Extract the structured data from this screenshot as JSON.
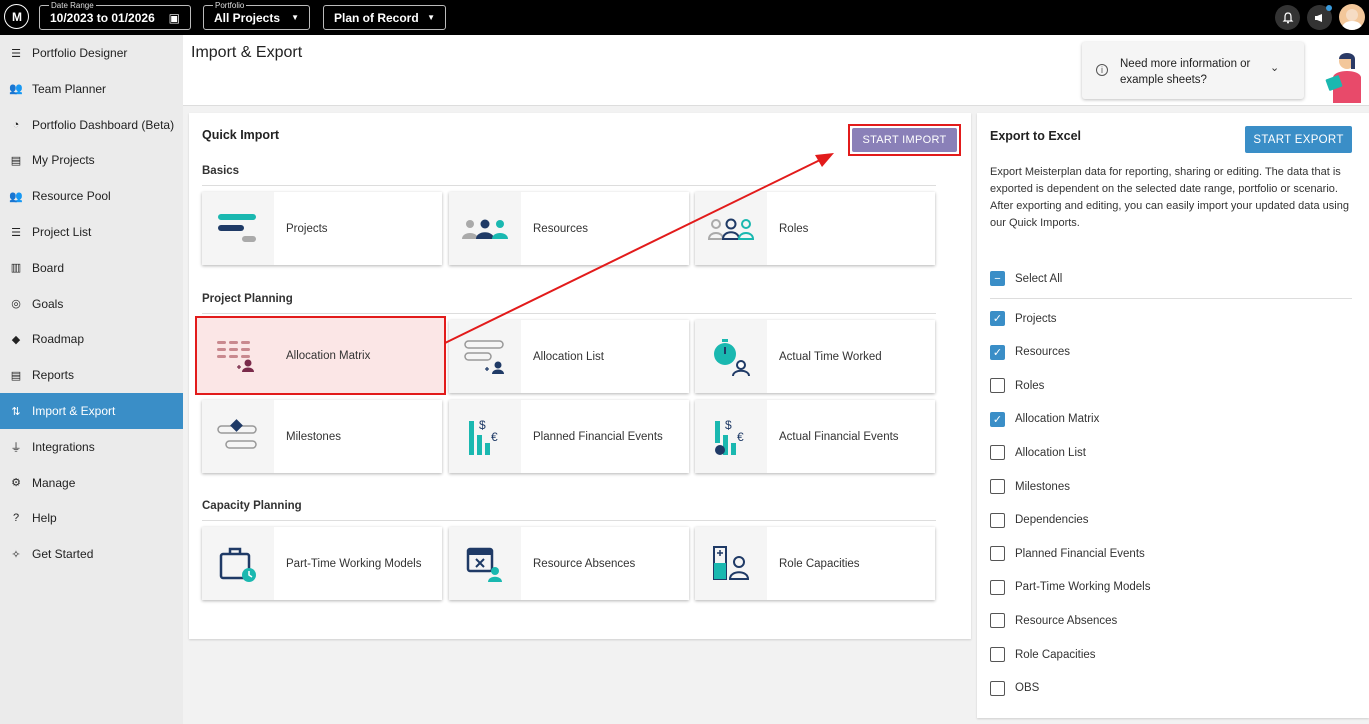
{
  "topbar": {
    "logo_text": "M",
    "date_range": {
      "label": "Date Range",
      "value": "10/2023 to 01/2026"
    },
    "portfolio": {
      "label": "Portfolio",
      "value": "All Projects"
    },
    "scenario": {
      "value": "Plan of Record"
    }
  },
  "sidebar": {
    "items": [
      {
        "label": "Portfolio Designer",
        "icon": "portfolio-designer-icon"
      },
      {
        "label": "Team Planner",
        "icon": "team-planner-icon"
      },
      {
        "label": "Portfolio Dashboard (Beta)",
        "icon": "dashboard-icon"
      },
      {
        "label": "My Projects",
        "icon": "my-projects-icon"
      },
      {
        "label": "Resource Pool",
        "icon": "resource-pool-icon"
      },
      {
        "label": "Project List",
        "icon": "list-icon"
      },
      {
        "label": "Board",
        "icon": "board-icon"
      },
      {
        "label": "Goals",
        "icon": "goals-icon"
      },
      {
        "label": "Roadmap",
        "icon": "roadmap-icon"
      },
      {
        "label": "Reports",
        "icon": "reports-icon"
      },
      {
        "label": "Import & Export",
        "icon": "import-export-icon",
        "active": true
      },
      {
        "label": "Integrations",
        "icon": "plug-icon"
      },
      {
        "label": "Manage",
        "icon": "gear-icon"
      },
      {
        "label": "Help",
        "icon": "help-icon"
      },
      {
        "label": "Get Started",
        "icon": "compass-icon"
      }
    ]
  },
  "header": {
    "title": "Import & Export",
    "help_text": "Need more information or example sheets?"
  },
  "quick_import": {
    "title": "Quick Import",
    "start_button": "START IMPORT",
    "sections": [
      {
        "title": "Basics",
        "tiles": [
          "Projects",
          "Resources",
          "Roles"
        ]
      },
      {
        "title": "Project Planning",
        "tiles": [
          "Allocation Matrix",
          "Allocation List",
          "Actual Time Worked",
          "Milestones",
          "Planned Financial Events",
          "Actual Financial Events"
        ]
      },
      {
        "title": "Capacity Planning",
        "tiles": [
          "Part-Time Working Models",
          "Resource Absences",
          "Role Capacities"
        ]
      }
    ],
    "highlighted_tile": "Allocation Matrix"
  },
  "export": {
    "title": "Export to Excel",
    "start_button": "START EXPORT",
    "description_1": "Export Meisterplan data for reporting, sharing or editing. The data that is exported is dependent on the selected date range, portfolio or scenario.",
    "description_2": "After exporting and editing, you can easily import your updated data using our Quick Imports.",
    "select_all": "Select All",
    "options": [
      {
        "label": "Projects",
        "checked": true
      },
      {
        "label": "Resources",
        "checked": true
      },
      {
        "label": "Roles",
        "checked": false
      },
      {
        "label": "Allocation Matrix",
        "checked": true
      },
      {
        "label": "Allocation List",
        "checked": false
      },
      {
        "label": "Milestones",
        "checked": false
      },
      {
        "label": "Dependencies",
        "checked": false
      },
      {
        "label": "Planned Financial Events",
        "checked": false
      },
      {
        "label": "Part-Time Working Models",
        "checked": false
      },
      {
        "label": "Resource Absences",
        "checked": false
      },
      {
        "label": "Role Capacities",
        "checked": false
      },
      {
        "label": "OBS",
        "checked": false
      }
    ]
  },
  "colors": {
    "accent": "#3a8ec7",
    "import_button": "#8a80b8",
    "highlight": "#e21b1b",
    "teal": "#1ab8b0",
    "navy": "#1f3a66"
  }
}
